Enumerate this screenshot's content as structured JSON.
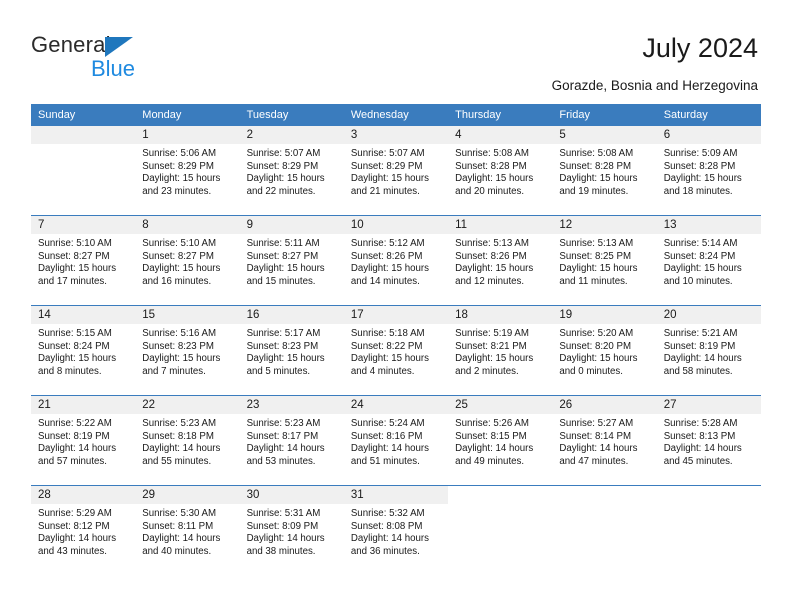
{
  "brand": {
    "name_part1": "General",
    "name_part2": "Blue",
    "triangle_color": "#1f77bd",
    "blue_color": "#1f8ae0"
  },
  "header": {
    "title": "July 2024",
    "subtitle": "Gorazde, Bosnia and Herzegovina"
  },
  "theme": {
    "header_bar": "#3A7CBE",
    "daynum_band": "#F0F0F0",
    "text": "#1a1a1a"
  },
  "weekdays": [
    "Sunday",
    "Monday",
    "Tuesday",
    "Wednesday",
    "Thursday",
    "Friday",
    "Saturday"
  ],
  "labels": {
    "sunrise": "Sunrise:",
    "sunset": "Sunset:",
    "daylight": "Daylight:"
  },
  "weeks": [
    [
      {
        "day": "",
        "sunrise": "",
        "sunset": "",
        "daylight": "",
        "empty": true
      },
      {
        "day": "1",
        "sunrise": "Sunrise: 5:06 AM",
        "sunset": "Sunset: 8:29 PM",
        "daylight": "Daylight: 15 hours and 23 minutes."
      },
      {
        "day": "2",
        "sunrise": "Sunrise: 5:07 AM",
        "sunset": "Sunset: 8:29 PM",
        "daylight": "Daylight: 15 hours and 22 minutes."
      },
      {
        "day": "3",
        "sunrise": "Sunrise: 5:07 AM",
        "sunset": "Sunset: 8:29 PM",
        "daylight": "Daylight: 15 hours and 21 minutes."
      },
      {
        "day": "4",
        "sunrise": "Sunrise: 5:08 AM",
        "sunset": "Sunset: 8:28 PM",
        "daylight": "Daylight: 15 hours and 20 minutes."
      },
      {
        "day": "5",
        "sunrise": "Sunrise: 5:08 AM",
        "sunset": "Sunset: 8:28 PM",
        "daylight": "Daylight: 15 hours and 19 minutes."
      },
      {
        "day": "6",
        "sunrise": "Sunrise: 5:09 AM",
        "sunset": "Sunset: 8:28 PM",
        "daylight": "Daylight: 15 hours and 18 minutes."
      }
    ],
    [
      {
        "day": "7",
        "sunrise": "Sunrise: 5:10 AM",
        "sunset": "Sunset: 8:27 PM",
        "daylight": "Daylight: 15 hours and 17 minutes."
      },
      {
        "day": "8",
        "sunrise": "Sunrise: 5:10 AM",
        "sunset": "Sunset: 8:27 PM",
        "daylight": "Daylight: 15 hours and 16 minutes."
      },
      {
        "day": "9",
        "sunrise": "Sunrise: 5:11 AM",
        "sunset": "Sunset: 8:27 PM",
        "daylight": "Daylight: 15 hours and 15 minutes."
      },
      {
        "day": "10",
        "sunrise": "Sunrise: 5:12 AM",
        "sunset": "Sunset: 8:26 PM",
        "daylight": "Daylight: 15 hours and 14 minutes."
      },
      {
        "day": "11",
        "sunrise": "Sunrise: 5:13 AM",
        "sunset": "Sunset: 8:26 PM",
        "daylight": "Daylight: 15 hours and 12 minutes."
      },
      {
        "day": "12",
        "sunrise": "Sunrise: 5:13 AM",
        "sunset": "Sunset: 8:25 PM",
        "daylight": "Daylight: 15 hours and 11 minutes."
      },
      {
        "day": "13",
        "sunrise": "Sunrise: 5:14 AM",
        "sunset": "Sunset: 8:24 PM",
        "daylight": "Daylight: 15 hours and 10 minutes."
      }
    ],
    [
      {
        "day": "14",
        "sunrise": "Sunrise: 5:15 AM",
        "sunset": "Sunset: 8:24 PM",
        "daylight": "Daylight: 15 hours and 8 minutes."
      },
      {
        "day": "15",
        "sunrise": "Sunrise: 5:16 AM",
        "sunset": "Sunset: 8:23 PM",
        "daylight": "Daylight: 15 hours and 7 minutes."
      },
      {
        "day": "16",
        "sunrise": "Sunrise: 5:17 AM",
        "sunset": "Sunset: 8:23 PM",
        "daylight": "Daylight: 15 hours and 5 minutes."
      },
      {
        "day": "17",
        "sunrise": "Sunrise: 5:18 AM",
        "sunset": "Sunset: 8:22 PM",
        "daylight": "Daylight: 15 hours and 4 minutes."
      },
      {
        "day": "18",
        "sunrise": "Sunrise: 5:19 AM",
        "sunset": "Sunset: 8:21 PM",
        "daylight": "Daylight: 15 hours and 2 minutes."
      },
      {
        "day": "19",
        "sunrise": "Sunrise: 5:20 AM",
        "sunset": "Sunset: 8:20 PM",
        "daylight": "Daylight: 15 hours and 0 minutes."
      },
      {
        "day": "20",
        "sunrise": "Sunrise: 5:21 AM",
        "sunset": "Sunset: 8:19 PM",
        "daylight": "Daylight: 14 hours and 58 minutes."
      }
    ],
    [
      {
        "day": "21",
        "sunrise": "Sunrise: 5:22 AM",
        "sunset": "Sunset: 8:19 PM",
        "daylight": "Daylight: 14 hours and 57 minutes."
      },
      {
        "day": "22",
        "sunrise": "Sunrise: 5:23 AM",
        "sunset": "Sunset: 8:18 PM",
        "daylight": "Daylight: 14 hours and 55 minutes."
      },
      {
        "day": "23",
        "sunrise": "Sunrise: 5:23 AM",
        "sunset": "Sunset: 8:17 PM",
        "daylight": "Daylight: 14 hours and 53 minutes."
      },
      {
        "day": "24",
        "sunrise": "Sunrise: 5:24 AM",
        "sunset": "Sunset: 8:16 PM",
        "daylight": "Daylight: 14 hours and 51 minutes."
      },
      {
        "day": "25",
        "sunrise": "Sunrise: 5:26 AM",
        "sunset": "Sunset: 8:15 PM",
        "daylight": "Daylight: 14 hours and 49 minutes."
      },
      {
        "day": "26",
        "sunrise": "Sunrise: 5:27 AM",
        "sunset": "Sunset: 8:14 PM",
        "daylight": "Daylight: 14 hours and 47 minutes."
      },
      {
        "day": "27",
        "sunrise": "Sunrise: 5:28 AM",
        "sunset": "Sunset: 8:13 PM",
        "daylight": "Daylight: 14 hours and 45 minutes."
      }
    ],
    [
      {
        "day": "28",
        "sunrise": "Sunrise: 5:29 AM",
        "sunset": "Sunset: 8:12 PM",
        "daylight": "Daylight: 14 hours and 43 minutes."
      },
      {
        "day": "29",
        "sunrise": "Sunrise: 5:30 AM",
        "sunset": "Sunset: 8:11 PM",
        "daylight": "Daylight: 14 hours and 40 minutes."
      },
      {
        "day": "30",
        "sunrise": "Sunrise: 5:31 AM",
        "sunset": "Sunset: 8:09 PM",
        "daylight": "Daylight: 14 hours and 38 minutes."
      },
      {
        "day": "31",
        "sunrise": "Sunrise: 5:32 AM",
        "sunset": "Sunset: 8:08 PM",
        "daylight": "Daylight: 14 hours and 36 minutes."
      },
      {
        "day": "",
        "sunrise": "",
        "sunset": "",
        "daylight": "",
        "blank": true
      },
      {
        "day": "",
        "sunrise": "",
        "sunset": "",
        "daylight": "",
        "blank": true
      },
      {
        "day": "",
        "sunrise": "",
        "sunset": "",
        "daylight": "",
        "blank": true
      }
    ]
  ]
}
